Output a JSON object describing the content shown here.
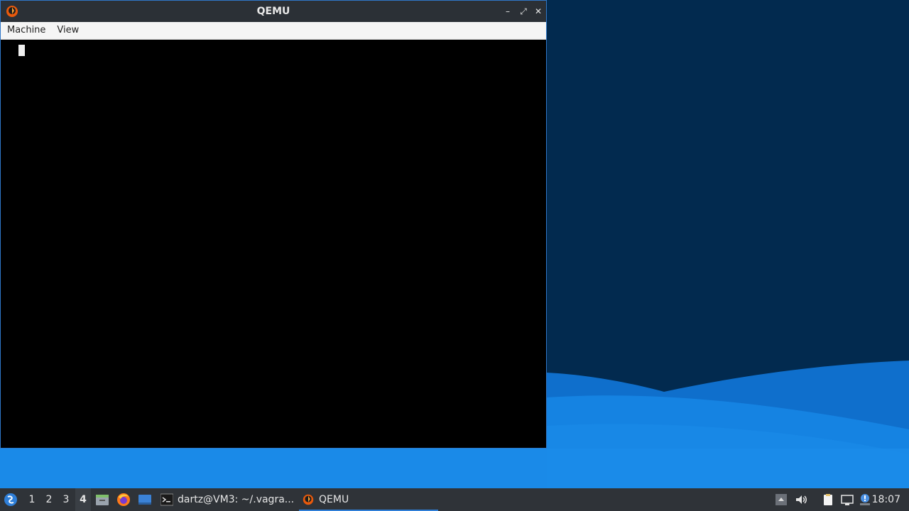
{
  "window": {
    "title": "QEMU",
    "icon": "qemu-logo-icon",
    "controls": [
      "minimize-icon",
      "maximize-icon",
      "close-icon"
    ],
    "minimize_glyph": "–",
    "maximize_glyph": "⤢",
    "close_glyph": "✕"
  },
  "menubar": {
    "items": [
      {
        "label": "Machine"
      },
      {
        "label": "View"
      }
    ]
  },
  "console": {
    "text": "",
    "cursor": "block"
  },
  "taskbar": {
    "start_icon": "start-menu-icon",
    "desktops": [
      {
        "label": "1",
        "active": false
      },
      {
        "label": "2",
        "active": false
      },
      {
        "label": "3",
        "active": false
      },
      {
        "label": "4",
        "active": true
      }
    ],
    "launchers": [
      "file-manager-icon",
      "firefox-icon",
      "show-desktop-icon"
    ],
    "tasks": [
      {
        "label": "dartz@VM3: ~/.vagra...",
        "icon": "terminal-icon",
        "active": false
      },
      {
        "label": "QEMU",
        "icon": "qemu-logo-icon",
        "active": true
      }
    ],
    "tray": [
      "tray-expand-icon",
      "volume-icon",
      "clipboard-icon",
      "network-icon",
      "notification-icon"
    ],
    "clock": "18:07"
  },
  "colors": {
    "desktop_bg": "#022a4f",
    "wave_light": "#1a8ae8",
    "titlebar": "#2b3036",
    "taskbar": "#2f3338",
    "accent": "#2f7fd8"
  }
}
